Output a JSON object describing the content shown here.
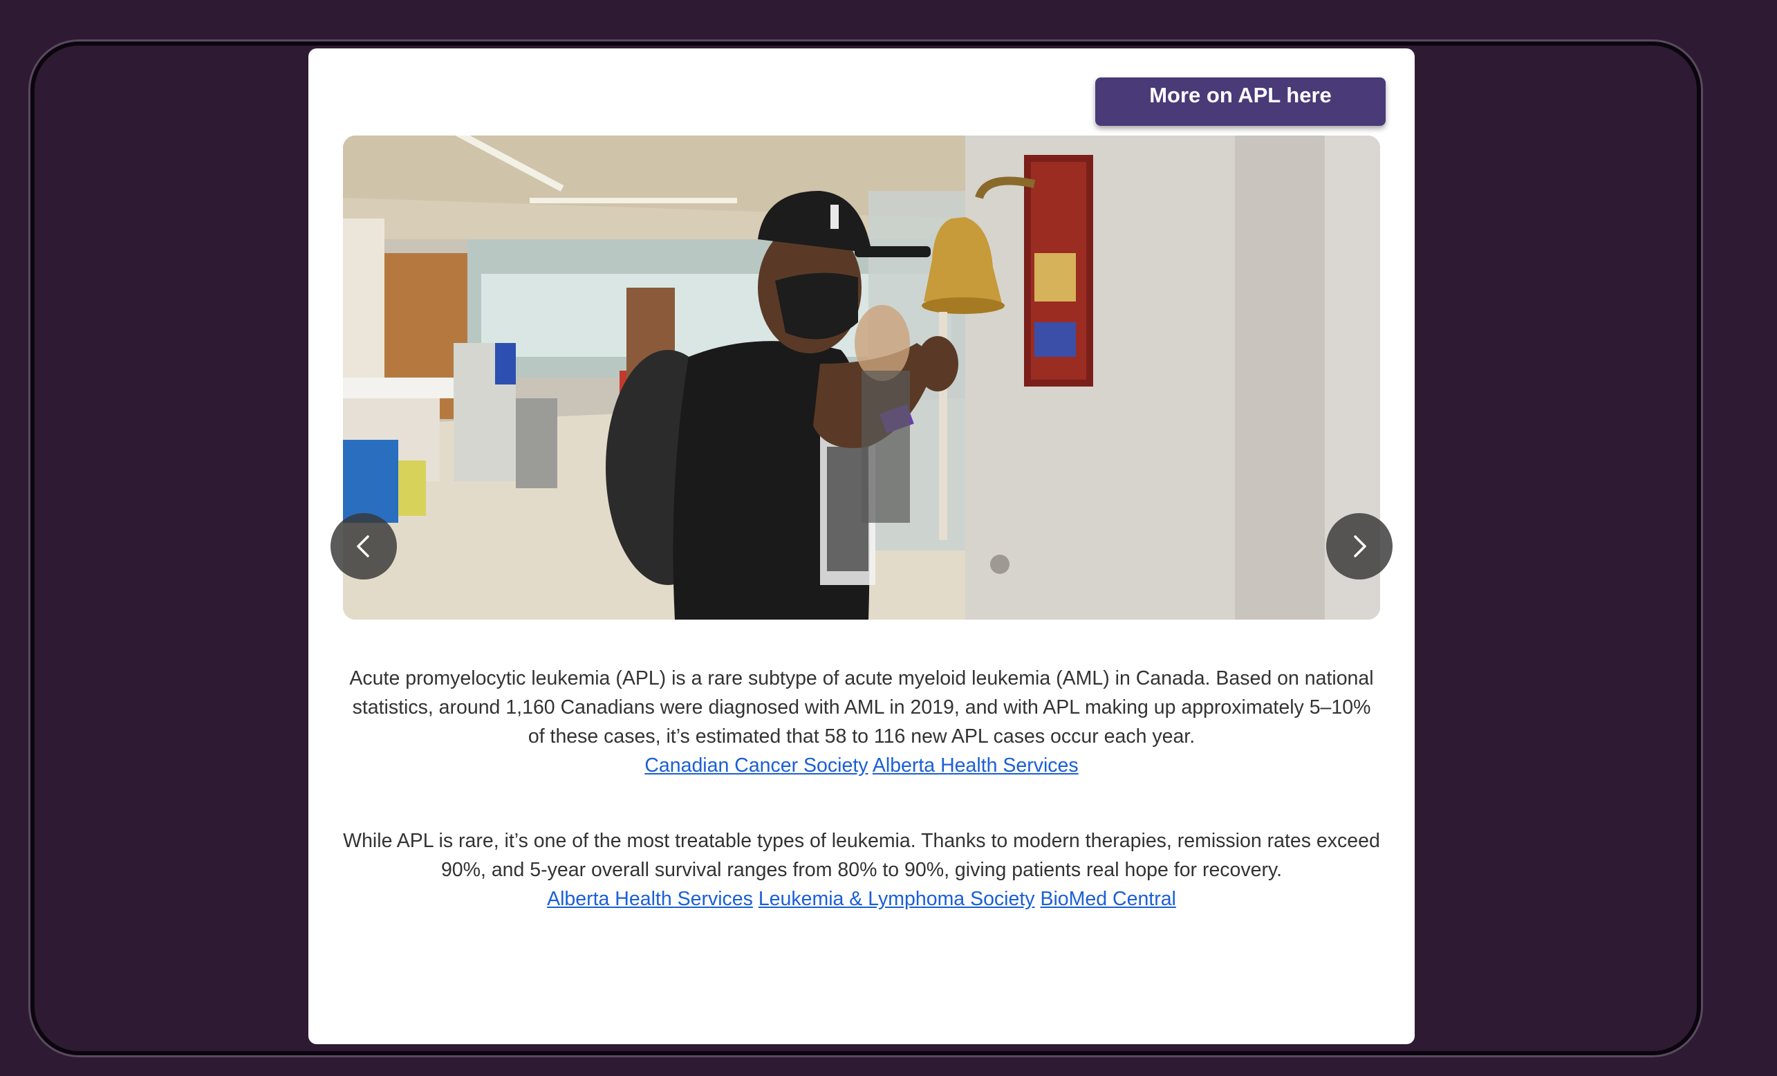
{
  "header": {
    "more_button_label": "More on APL here"
  },
  "carousel": {
    "image_alt": "Patient in black cap and face mask ringing a brass bell in a hospital treatment area",
    "prev_icon": "chevron-left-icon",
    "next_icon": "chevron-right-icon"
  },
  "content": {
    "paragraph1": "Acute promyelocytic leukemia (APL) is a rare subtype of acute myeloid leukemia (AML) in Canada. Based on national statistics, around 1,160 Canadians were diagnosed with AML in 2019, and with APL making up approximately 5–10% of these cases, it’s estimated that 58 to 116 new APL cases occur each year.",
    "paragraph1_links": [
      "Canadian Cancer Society",
      "Alberta Health Services"
    ],
    "paragraph2": "While APL is rare, it’s one of the most treatable types of leukemia. Thanks to modern therapies, remission rates exceed 90%, and 5-year overall survival ranges from 80% to 90%, giving patients real hope for recovery.",
    "paragraph2_links": [
      "Alberta Health Services",
      "Leukemia & Lymphoma Society",
      "BioMed Central"
    ]
  },
  "colors": {
    "page_background": "#2e1b33",
    "button_background": "#4a3a78",
    "link": "#1a5fd6",
    "text": "#333333"
  }
}
